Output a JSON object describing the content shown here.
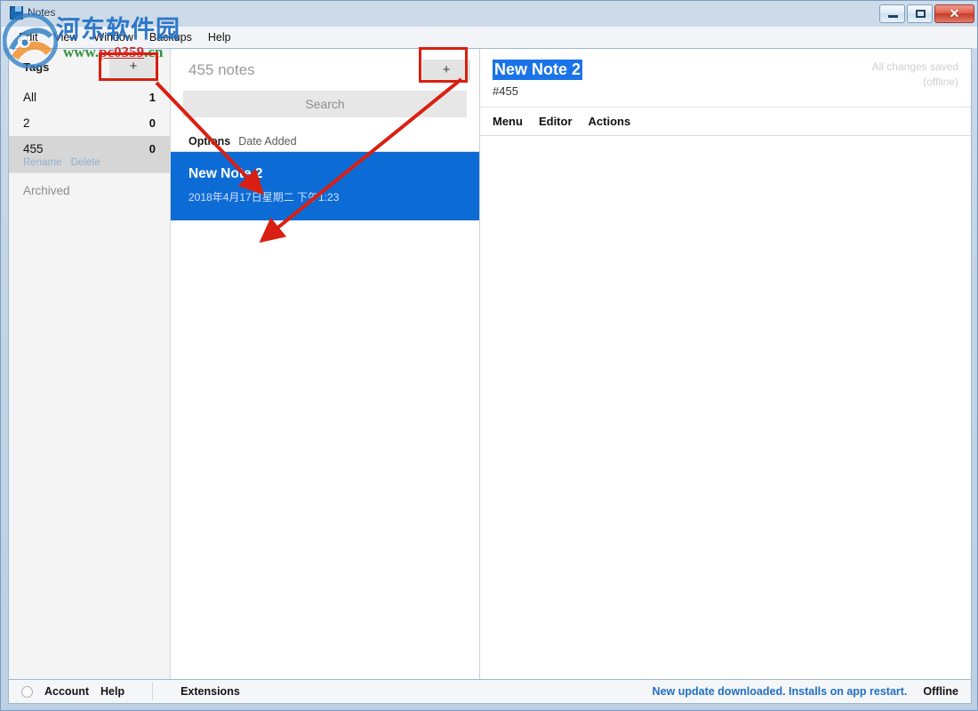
{
  "window": {
    "title": "Notes",
    "icon": "note-icon",
    "controls": {
      "minimize": "minimize-button",
      "maximize": "maximize-button",
      "close": "✕"
    }
  },
  "menubar": {
    "items": [
      {
        "label": "Edit"
      },
      {
        "label": "View"
      },
      {
        "label": "Window"
      },
      {
        "label": "Backups"
      },
      {
        "label": "Help"
      }
    ]
  },
  "sidebar": {
    "header": {
      "title": "Tags",
      "add_label": "+"
    },
    "tags": [
      {
        "label": "All",
        "count": "1",
        "selected": false
      },
      {
        "label": "2",
        "count": "0",
        "selected": false
      },
      {
        "label": "455",
        "count": "0",
        "selected": true,
        "rename_label": "Rename",
        "delete_label": "Delete"
      }
    ],
    "archived_label": "Archived"
  },
  "notes_list": {
    "count_label": "455 notes",
    "add_label": "+",
    "search": {
      "value": "",
      "placeholder": "Search"
    },
    "options_label": "Options",
    "sort_label": "Date Added",
    "items": [
      {
        "title": "New Note 2",
        "date": "2018年4月17日星期二 下午1:23",
        "selected": true
      }
    ]
  },
  "editor": {
    "title_value": "New Note 2",
    "tag_line": "#455",
    "save_status_line1": "All changes saved",
    "save_status_line2": "(offline)",
    "toolbar": [
      {
        "label": "Menu"
      },
      {
        "label": "Editor"
      },
      {
        "label": "Actions"
      }
    ],
    "body_text": ""
  },
  "statusbar": {
    "account_label": "Account",
    "help_label": "Help",
    "extensions_label": "Extensions",
    "update_message": "New update downloaded. Installs on app restart.",
    "connection_status": "Offline"
  },
  "watermark": {
    "site_name": "河东软件园",
    "url_prefix": "www.",
    "url_name": "pc0359",
    "url_suffix": ".cn"
  },
  "colors": {
    "selection_blue": "#0d6bd6",
    "title_highlight_blue": "#1a73e8",
    "annotation_red": "#d91f11",
    "link_blue": "#1f6fc4",
    "watermark_blue": "#1f6fc4"
  }
}
